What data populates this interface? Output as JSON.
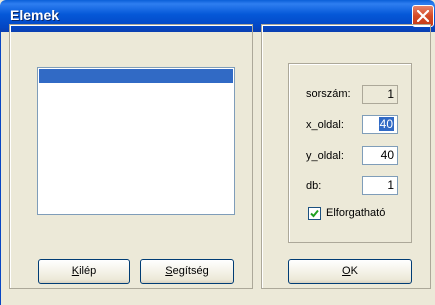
{
  "window": {
    "title": "Elemek",
    "close_icon": "close-icon"
  },
  "list": {
    "items": [
      ""
    ]
  },
  "fields": {
    "sorszam_label": "sorszám:",
    "sorszam_value": "1",
    "x_oldal_label": "x_oldal:",
    "x_oldal_value": "40",
    "y_oldal_label": "y_oldal:",
    "y_oldal_value": "40",
    "db_label": "db:",
    "db_value": "1"
  },
  "checkbox": {
    "label": "Elforgatható",
    "checked": true
  },
  "buttons": {
    "kilep_first": "K",
    "kilep_rest": "ilép",
    "segitseg_first": "S",
    "segitseg_rest": "egítség",
    "ok_first": "O",
    "ok_rest": "K"
  }
}
